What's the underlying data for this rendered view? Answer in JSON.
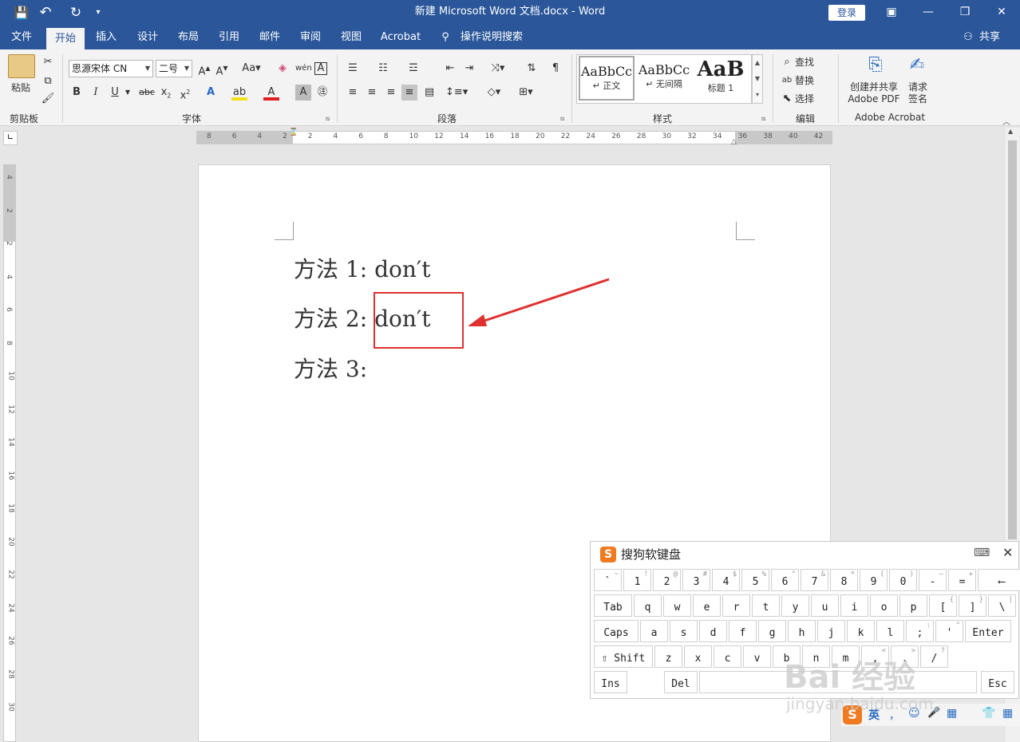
{
  "window": {
    "title": "新建 Microsoft Word 文档.docx  -  Word",
    "login": "登录",
    "share": "共享",
    "qat": {
      "save": "💾",
      "undo": "↶",
      "redo": "↻",
      "more": "▾"
    }
  },
  "tabs": [
    "文件",
    "开始",
    "插入",
    "设计",
    "布局",
    "引用",
    "邮件",
    "审阅",
    "视图",
    "Acrobat",
    "操作说明搜索"
  ],
  "active_tab": "开始",
  "ribbon": {
    "clipboard": {
      "label": "剪贴板",
      "paste": "粘贴"
    },
    "font": {
      "label": "字体",
      "font_name": "思源宋体 CN",
      "font_size": "二号"
    },
    "paragraph": {
      "label": "段落"
    },
    "styles": {
      "label": "样式",
      "items": [
        {
          "preview": "AaBbCc",
          "name": "↵ 正文"
        },
        {
          "preview": "AaBbCc",
          "name": "↵ 无间隔"
        },
        {
          "preview": "AaB",
          "name": "标题 1"
        }
      ]
    },
    "editing": {
      "label": "编辑",
      "find": "查找",
      "replace": "替换",
      "select": "选择"
    },
    "acrobat": {
      "label": "Adobe Acrobat",
      "create_line1": "创建并共享",
      "create_line2": "Adobe PDF",
      "sign_line1": "请求",
      "sign_line2": "签名"
    }
  },
  "ruler": {
    "h_ticks": [
      "8",
      "6",
      "4",
      "2",
      "2",
      "4",
      "6",
      "8",
      "10",
      "12",
      "14",
      "16",
      "18",
      "20",
      "22",
      "24",
      "26",
      "28",
      "30",
      "32",
      "34",
      "36",
      "38",
      "40",
      "42"
    ],
    "v_ticks": [
      "4",
      "2",
      "2",
      "4",
      "6",
      "8",
      "10",
      "12",
      "14",
      "16",
      "18",
      "20",
      "22",
      "24",
      "26",
      "28",
      "30"
    ]
  },
  "document": {
    "lines": [
      {
        "label": "方法 1:",
        "text": "don′t"
      },
      {
        "label": "方法 2:",
        "text": "don′t"
      },
      {
        "label": "方法 3:",
        "text": ""
      }
    ]
  },
  "annotation": {
    "box_color": "#e03030",
    "arrow_color": "#e03030"
  },
  "keyboard": {
    "title": "搜狗软键盘",
    "rows": [
      [
        {
          "m": "`",
          "s": "~"
        },
        {
          "m": "1",
          "s": "!"
        },
        {
          "m": "2",
          "s": "@"
        },
        {
          "m": "3",
          "s": "#"
        },
        {
          "m": "4",
          "s": "$"
        },
        {
          "m": "5",
          "s": "%"
        },
        {
          "m": "6",
          "s": "^"
        },
        {
          "m": "7",
          "s": "&"
        },
        {
          "m": "8",
          "s": "*"
        },
        {
          "m": "9",
          "s": "("
        },
        {
          "m": "0",
          "s": ")"
        },
        {
          "m": "-",
          "s": "—"
        },
        {
          "m": "=",
          "s": "+"
        },
        {
          "m": "⟵",
          "s": ""
        }
      ],
      [
        {
          "m": "Tab",
          "s": ""
        },
        {
          "m": "q",
          "s": ""
        },
        {
          "m": "w",
          "s": ""
        },
        {
          "m": "e",
          "s": ""
        },
        {
          "m": "r",
          "s": ""
        },
        {
          "m": "t",
          "s": ""
        },
        {
          "m": "y",
          "s": ""
        },
        {
          "m": "u",
          "s": ""
        },
        {
          "m": "i",
          "s": ""
        },
        {
          "m": "o",
          "s": ""
        },
        {
          "m": "p",
          "s": ""
        },
        {
          "m": "[",
          "s": "{"
        },
        {
          "m": "]",
          "s": "}"
        },
        {
          "m": "\\",
          "s": "|"
        }
      ],
      [
        {
          "m": "Caps",
          "s": ""
        },
        {
          "m": "a",
          "s": ""
        },
        {
          "m": "s",
          "s": ""
        },
        {
          "m": "d",
          "s": ""
        },
        {
          "m": "f",
          "s": ""
        },
        {
          "m": "g",
          "s": ""
        },
        {
          "m": "h",
          "s": ""
        },
        {
          "m": "j",
          "s": ""
        },
        {
          "m": "k",
          "s": ""
        },
        {
          "m": "l",
          "s": ""
        },
        {
          "m": ";",
          "s": ":"
        },
        {
          "m": "'",
          "s": "\""
        },
        {
          "m": "Enter",
          "s": ""
        }
      ],
      [
        {
          "m": "⇧ Shift",
          "s": ""
        },
        {
          "m": "z",
          "s": ""
        },
        {
          "m": "x",
          "s": ""
        },
        {
          "m": "c",
          "s": ""
        },
        {
          "m": "v",
          "s": ""
        },
        {
          "m": "b",
          "s": ""
        },
        {
          "m": "n",
          "s": ""
        },
        {
          "m": "m",
          "s": ""
        },
        {
          "m": ",",
          "s": "<"
        },
        {
          "m": ".",
          "s": ">"
        },
        {
          "m": "/",
          "s": "?"
        }
      ],
      [
        {
          "m": "Ins",
          "s": ""
        },
        {
          "m": "Del",
          "s": ""
        },
        {
          "m": "",
          "s": ""
        },
        {
          "m": "Esc",
          "s": ""
        }
      ]
    ]
  },
  "ime_bar": {
    "lang": "英",
    "items": [
      "，",
      "☺",
      "🎤",
      "▦",
      "👕",
      "▦"
    ]
  },
  "watermark": {
    "brand": "Bai 经验",
    "url": "jingyan.baidu.com"
  }
}
